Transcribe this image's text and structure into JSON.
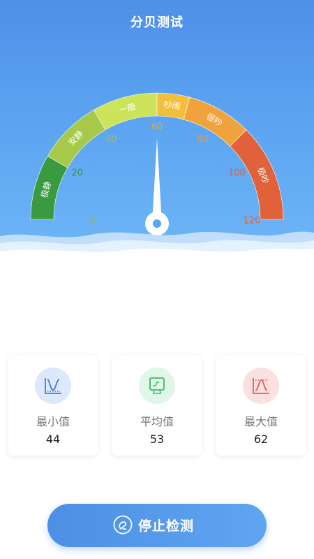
{
  "header": {
    "title": "分贝测试"
  },
  "gauge": {
    "min": 0,
    "max": 120,
    "needle_value": 60,
    "ticks": [
      "0",
      "20",
      "40",
      "60",
      "80",
      "100",
      "120"
    ],
    "segments": [
      {
        "label": "极静",
        "from": 0,
        "to": 20,
        "color": "#3a9a3f"
      },
      {
        "label": "安静",
        "from": 20,
        "to": 40,
        "color": "#a6c94a"
      },
      {
        "label": "一般",
        "from": 40,
        "to": 60,
        "color": "#cde35a"
      },
      {
        "label": "吵闹",
        "from": 60,
        "to": 70,
        "color": "#f2bf3b"
      },
      {
        "label": "很吵",
        "from": 70,
        "to": 90,
        "color": "#f0a33d"
      },
      {
        "label": "极吵",
        "from": 90,
        "to": 120,
        "color": "#e0613a"
      }
    ],
    "tick_colors": [
      "#7fb86a",
      "#3a9a3f",
      "#9fbf44",
      "#e2a935",
      "#e79a3a",
      "#e0613a",
      "#e0613a"
    ]
  },
  "stats": [
    {
      "label": "最小值",
      "value": "44",
      "icon": "min-curve-icon",
      "bg": "#dce8fb",
      "color": "#4a78d6"
    },
    {
      "label": "平均值",
      "value": "53",
      "icon": "average-monitor-icon",
      "bg": "#dff6e8",
      "color": "#3dbb6a"
    },
    {
      "label": "最大值",
      "value": "62",
      "icon": "max-curve-icon",
      "bg": "#fbe0e0",
      "color": "#e06060"
    }
  ],
  "action": {
    "stop_label": "停止检测",
    "icon": "stop-detect-icon"
  }
}
